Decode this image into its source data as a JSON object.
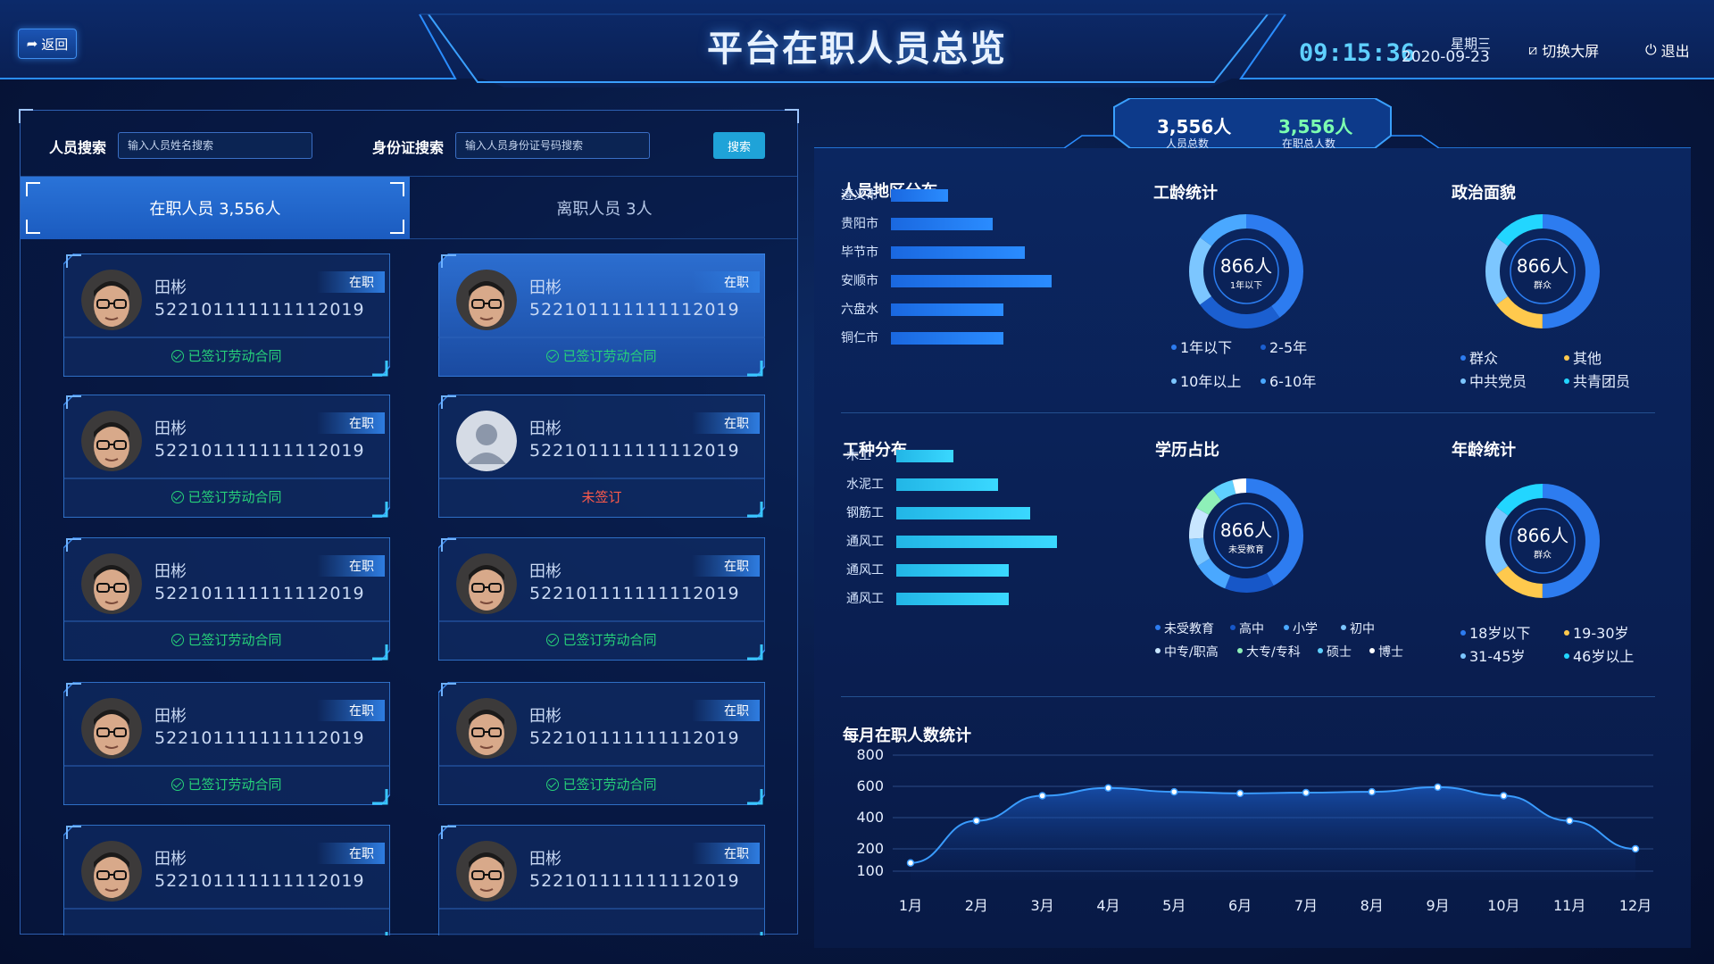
{
  "header": {
    "back_label": "返回",
    "title": "平台在职人员总览",
    "time": "09:15:36",
    "weekday": "星期三",
    "date": "2020-09-23",
    "switch_label": "切换大屏",
    "logout_label": "退出"
  },
  "search": {
    "name_label": "人员搜索",
    "name_placeholder": "输入人员姓名搜索",
    "id_label": "身份证搜索",
    "id_placeholder": "输入人员身份证号码搜索",
    "button_label": "搜索"
  },
  "tabs": {
    "active": "在职人员 3,556人",
    "inactive": "离职人员 3人"
  },
  "cards": [
    {
      "name": "田彬",
      "id": "522101111111112019",
      "badge": "在职",
      "status": "已签订劳动合同",
      "signed": true,
      "highlight": false,
      "placeholder_avatar": false
    },
    {
      "name": "田彬",
      "id": "522101111111112019",
      "badge": "在职",
      "status": "已签订劳动合同",
      "signed": true,
      "highlight": true,
      "placeholder_avatar": false
    },
    {
      "name": "田彬",
      "id": "522101111111112019",
      "badge": "在职",
      "status": "已签订劳动合同",
      "signed": true,
      "highlight": false,
      "placeholder_avatar": false
    },
    {
      "name": "田彬",
      "id": "522101111111112019",
      "badge": "在职",
      "status": "未签订",
      "signed": false,
      "highlight": false,
      "placeholder_avatar": true
    },
    {
      "name": "田彬",
      "id": "522101111111112019",
      "badge": "在职",
      "status": "已签订劳动合同",
      "signed": true,
      "highlight": false,
      "placeholder_avatar": false
    },
    {
      "name": "田彬",
      "id": "522101111111112019",
      "badge": "在职",
      "status": "已签订劳动合同",
      "signed": true,
      "highlight": false,
      "placeholder_avatar": false
    },
    {
      "name": "田彬",
      "id": "522101111111112019",
      "badge": "在职",
      "status": "已签订劳动合同",
      "signed": true,
      "highlight": false,
      "placeholder_avatar": false
    },
    {
      "name": "田彬",
      "id": "522101111111112019",
      "badge": "在职",
      "status": "已签订劳动合同",
      "signed": true,
      "highlight": false,
      "placeholder_avatar": false
    },
    {
      "name": "田彬",
      "id": "522101111111112019",
      "badge": "在职",
      "status": "",
      "signed": true,
      "highlight": false,
      "placeholder_avatar": false
    },
    {
      "name": "田彬",
      "id": "522101111111112019",
      "badge": "在职",
      "status": "",
      "signed": true,
      "highlight": false,
      "placeholder_avatar": false
    }
  ],
  "summary": {
    "total_value": "3,556人",
    "total_label": "人员总数",
    "active_value": "3,556人",
    "active_label": "在职总人数"
  },
  "colors": {
    "accent": "#1fa3d8",
    "signed": "#27d27a",
    "unsigned": "#ff5a4a",
    "highlight_num": "#7cffb0",
    "donut_blue": "#2d7cf0",
    "donut_light": "#7cc6ff",
    "donut_cyan": "#22d6ff",
    "donut_yellow": "#ffc94d",
    "donut_green": "#8ef0b8"
  },
  "charts": {
    "region": {
      "title": "人员地区分布",
      "categories": [
        "遵义市",
        "贵阳市",
        "毕节市",
        "安顺市",
        "六盘水",
        "铜仁市"
      ],
      "values": [
        64,
        114,
        150,
        180,
        126,
        126
      ]
    },
    "worktype": {
      "title": "工种分布",
      "categories": [
        "木工",
        "水泥工",
        "钢筋工",
        "通风工",
        "通风工",
        "通风工"
      ],
      "values": [
        64,
        114,
        150,
        180,
        126,
        126
      ]
    },
    "seniority": {
      "title": "工龄统计",
      "center_value": "866人",
      "center_label": "1年以下",
      "legend": [
        "1年以下",
        "2-5年",
        "10年以上",
        "6-10年"
      ],
      "values": [
        40,
        25,
        20,
        15
      ]
    },
    "politics": {
      "title": "政治面貌",
      "center_value": "866人",
      "center_label": "群众",
      "legend": [
        "群众",
        "其他",
        "中共党员",
        "共青团员"
      ],
      "values": [
        50,
        15,
        20,
        15
      ]
    },
    "education": {
      "title": "学历占比",
      "center_value": "866人",
      "center_label": "未受教育",
      "legend": [
        "未受教育",
        "高中",
        "小学",
        "初中",
        "中专/职高",
        "大专/专科",
        "硕士",
        "博士"
      ],
      "values": [
        42,
        14,
        10,
        8,
        9,
        7,
        6,
        4
      ]
    },
    "age": {
      "title": "年龄统计",
      "center_value": "866人",
      "center_label": "群众",
      "legend": [
        "18岁以下",
        "19-30岁",
        "31-45岁",
        "46岁以上"
      ],
      "values": [
        50,
        15,
        20,
        15
      ]
    },
    "monthly": {
      "title": "每月在职人数统计",
      "categories": [
        "1月",
        "2月",
        "3月",
        "4月",
        "5月",
        "6月",
        "7月",
        "8月",
        "9月",
        "10月",
        "11月",
        "12月"
      ],
      "values": [
        110,
        380,
        540,
        590,
        565,
        555,
        560,
        565,
        595,
        540,
        380,
        200
      ],
      "yticks": [
        100,
        200,
        400,
        600,
        800
      ]
    }
  },
  "chart_data": {
    "type": "line",
    "title": "每月在职人数统计",
    "categories": [
      "1月",
      "2月",
      "3月",
      "4月",
      "5月",
      "6月",
      "7月",
      "8月",
      "9月",
      "10月",
      "11月",
      "12月"
    ],
    "values": [
      110,
      380,
      540,
      590,
      565,
      555,
      560,
      565,
      595,
      540,
      380,
      200
    ],
    "ylim": [
      0,
      800
    ]
  }
}
